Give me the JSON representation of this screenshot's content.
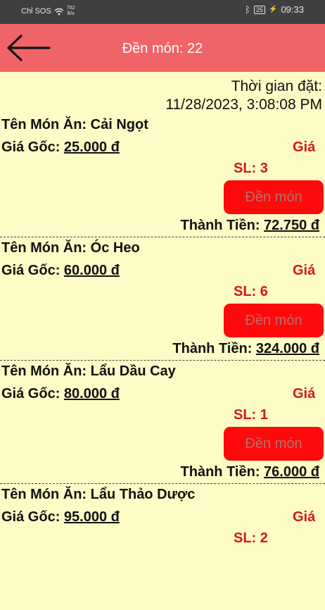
{
  "status_bar": {
    "carrier": "Chỉ SOS",
    "net_speed_value": "752",
    "net_speed_unit": "B/s",
    "battery": "25",
    "time": "09:33"
  },
  "header": {
    "title": "Đền món: 22"
  },
  "order": {
    "time_label": "Thời gian đặt:",
    "time_value": "11/28/2023, 3:08:08 PM"
  },
  "items": [
    {
      "name_label": "Tên Món Ăn: Cải Ngọt",
      "orig_label": "Giá Gốc: ",
      "orig_value": "25.000 đ",
      "disc_label": "Giá",
      "qty_label": "SL: 3",
      "button_label": "Đền món",
      "total_label": "Thành Tiền: ",
      "total_value": "72.750 đ"
    },
    {
      "name_label": "Tên Món Ăn: Óc Heo",
      "orig_label": "Giá Gốc: ",
      "orig_value": "60.000 đ",
      "disc_label": "Giá",
      "qty_label": "SL: 6",
      "button_label": "Đền món",
      "total_label": "Thành Tiền: ",
      "total_value": "324.000 đ"
    },
    {
      "name_label": "Tên Món Ăn: Lẩu Dầu Cay",
      "orig_label": "Giá Gốc: ",
      "orig_value": "80.000 đ",
      "disc_label": "Giá",
      "qty_label": "SL: 1",
      "button_label": "Đền món",
      "total_label": "Thành Tiền: ",
      "total_value": "76.000 đ"
    },
    {
      "name_label": "Tên Món Ăn: Lẩu Thảo Dược",
      "orig_label": "Giá Gốc: ",
      "orig_value": "95.000 đ",
      "disc_label": "Giá",
      "qty_label": "SL: 2"
    }
  ],
  "colors": {
    "header_bg": "#f06468",
    "page_bg": "#fdfbc6",
    "accent_red": "#d41818",
    "button_bg": "#ff0a0a"
  }
}
